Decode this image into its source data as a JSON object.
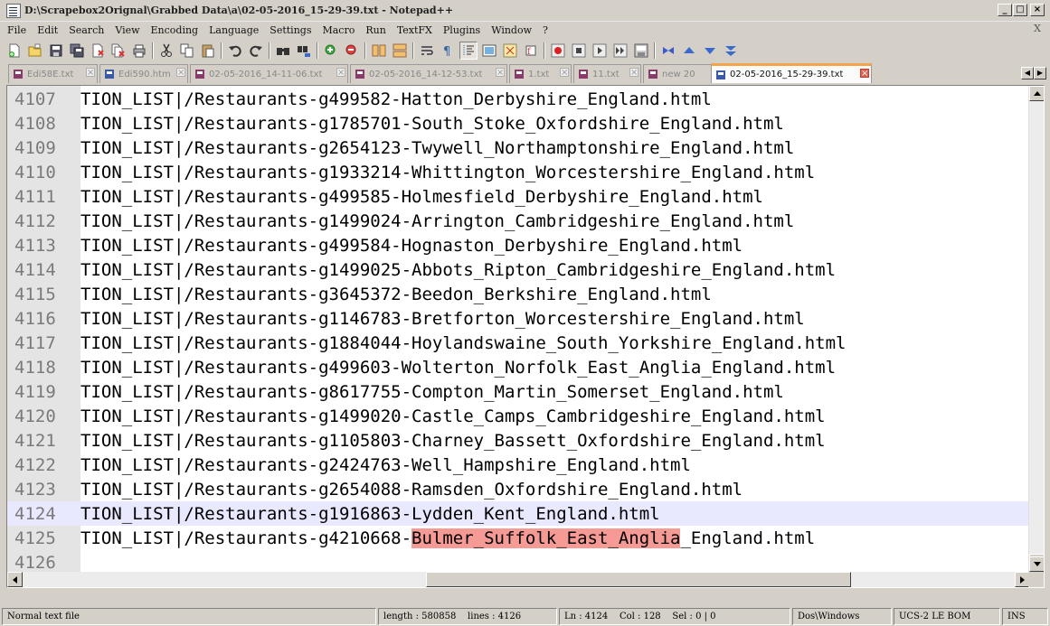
{
  "window": {
    "title": "D:\\Scrapebox2Orignal\\Grabbed Data\\a\\02-05-2016_15-29-39.txt - Notepad++",
    "buttons": {
      "minimize": "_",
      "maximize": "□",
      "close": "×"
    }
  },
  "menu": {
    "items": [
      "File",
      "Edit",
      "Search",
      "View",
      "Encoding",
      "Language",
      "Settings",
      "Macro",
      "Run",
      "TextFX",
      "Plugins",
      "Window",
      "?"
    ],
    "close_glyph": "X"
  },
  "toolbar": {
    "icons": [
      "new-file-icon",
      "open-file-icon",
      "save-icon",
      "save-all-icon",
      "close-icon",
      "close-all-icon",
      "print-icon",
      "cut-icon",
      "copy-icon",
      "paste-icon",
      "undo-icon",
      "redo-icon",
      "find-icon",
      "replace-icon",
      "zoom-in-icon",
      "zoom-out-icon",
      "sync-vertical-icon",
      "sync-horizontal-icon",
      "word-wrap-icon",
      "show-all-chars-icon",
      "indent-guide-icon",
      "user-lang-icon",
      "doc-map-icon",
      "function-list-icon",
      "record-macro-icon",
      "stop-record-icon",
      "play-macro-icon",
      "run-multiple-icon",
      "save-macro-icon",
      "compare-icon",
      "prev-diff-icon",
      "next-diff-icon",
      "last-diff-icon"
    ]
  },
  "tabs": [
    {
      "label": "Edi58E.txt",
      "active": false,
      "color": "#8a3a6a"
    },
    {
      "label": "Edi590.htm",
      "active": false,
      "color": "#3a5aa8"
    },
    {
      "label": "02-05-2016_14-11-06.txt",
      "active": false,
      "color": "#8a3a6a"
    },
    {
      "label": "02-05-2016_14-12-53.txt",
      "active": false,
      "color": "#8a3a6a"
    },
    {
      "label": "1.txt",
      "active": false,
      "color": "#8a3a6a"
    },
    {
      "label": "11.txt",
      "active": false,
      "color": "#8a3a6a"
    },
    {
      "label": "new 20",
      "active": false,
      "color": "#8a3a6a"
    },
    {
      "label": "02-05-2016_15-29-39.txt",
      "active": true,
      "color": "#3a5aa8"
    }
  ],
  "editor": {
    "lines": [
      {
        "num": "4107",
        "text": "TION_LIST|/Restaurants-g499582-Hatton_Derbyshire_England.html"
      },
      {
        "num": "4108",
        "text": "TION_LIST|/Restaurants-g1785701-South_Stoke_Oxfordshire_England.html"
      },
      {
        "num": "4109",
        "text": "TION_LIST|/Restaurants-g2654123-Twywell_Northamptonshire_England.html"
      },
      {
        "num": "4110",
        "text": "TION_LIST|/Restaurants-g1933214-Whittington_Worcestershire_England.html"
      },
      {
        "num": "4111",
        "text": "TION_LIST|/Restaurants-g499585-Holmesfield_Derbyshire_England.html"
      },
      {
        "num": "4112",
        "text": "TION_LIST|/Restaurants-g1499024-Arrington_Cambridgeshire_England.html"
      },
      {
        "num": "4113",
        "text": "TION_LIST|/Restaurants-g499584-Hognaston_Derbyshire_England.html"
      },
      {
        "num": "4114",
        "text": "TION_LIST|/Restaurants-g1499025-Abbots_Ripton_Cambridgeshire_England.html"
      },
      {
        "num": "4115",
        "text": "TION_LIST|/Restaurants-g3645372-Beedon_Berkshire_England.html"
      },
      {
        "num": "4116",
        "text": "TION_LIST|/Restaurants-g1146783-Bretforton_Worcestershire_England.html"
      },
      {
        "num": "4117",
        "text": "TION_LIST|/Restaurants-g1884044-Hoylandswaine_South_Yorkshire_England.html"
      },
      {
        "num": "4118",
        "text": "TION_LIST|/Restaurants-g499603-Wolterton_Norfolk_East_Anglia_England.html"
      },
      {
        "num": "4119",
        "text": "TION_LIST|/Restaurants-g8617755-Compton_Martin_Somerset_England.html"
      },
      {
        "num": "4120",
        "text": "TION_LIST|/Restaurants-g1499020-Castle_Camps_Cambridgeshire_England.html"
      },
      {
        "num": "4121",
        "text": "TION_LIST|/Restaurants-g1105803-Charney_Bassett_Oxfordshire_England.html"
      },
      {
        "num": "4122",
        "text": "TION_LIST|/Restaurants-g2424763-Well_Hampshire_England.html"
      },
      {
        "num": "4123",
        "text": "TION_LIST|/Restaurants-g2654088-Ramsden_Oxfordshire_England.html"
      },
      {
        "num": "4124",
        "text": "TION_LIST|/Restaurants-g1916863-Lydden_Kent_England.html",
        "current": true
      },
      {
        "num": "4125",
        "text_before": "TION_LIST|/Restaurants-g4210668-",
        "text_highlight": "Bulmer_Suffolk_East_Anglia",
        "text_after": "_England.html"
      },
      {
        "num": "4126",
        "text": ""
      }
    ],
    "highlight_color": "#f59a94",
    "current_line_color": "#e8e8ff"
  },
  "statusbar": {
    "file_type": "Normal text file",
    "length": "length : 580858",
    "lines": "lines : 4126",
    "ln": "Ln : 4124",
    "col": "Col : 128",
    "sel": "Sel : 0 | 0",
    "eol": "Dos\\Windows",
    "encoding": "UCS-2 LE BOM",
    "mode": "INS"
  }
}
